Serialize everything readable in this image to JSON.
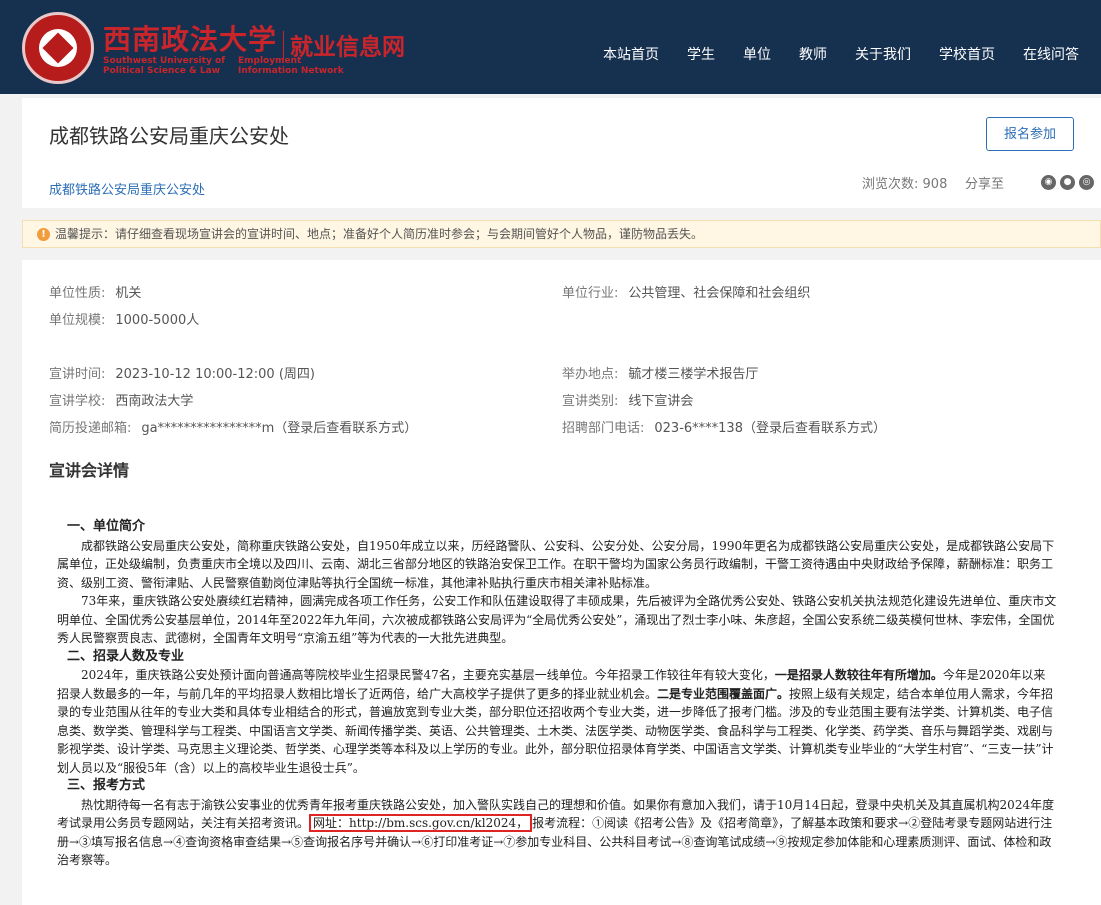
{
  "header": {
    "school_name": "西南政法大学",
    "site_name": "就业信息网",
    "school_name_en_line1": "Southwest University of",
    "school_name_en_line2": "Political Science & Law",
    "site_name_en_line1": "Employment",
    "site_name_en_line2": "Information Network",
    "nav": [
      {
        "label": "本站首页"
      },
      {
        "label": "学生"
      },
      {
        "label": "单位"
      },
      {
        "label": "教师"
      },
      {
        "label": "关于我们"
      },
      {
        "label": "学校首页"
      },
      {
        "label": "在线问答"
      }
    ]
  },
  "event": {
    "title": "成都铁路公安局重庆公安处",
    "company_link": "成都铁路公安局重庆公安处",
    "apply_button": "报名参加",
    "views_label": "浏览次数:",
    "views_count": "908",
    "share_label": "分享至"
  },
  "notice": {
    "text": "温馨提示：请仔细查看现场宣讲会的宣讲时间、地点；准备好个人简历准时参会；与会期间管好个人物品，谨防物品丢失。"
  },
  "info": {
    "nature_label": "单位性质:",
    "nature": "机关",
    "industry_label": "单位行业:",
    "industry": "公共管理、社会保障和社会组织",
    "scale_label": "单位规模:",
    "scale": "1000-5000人",
    "time_label": "宣讲时间:",
    "time": "2023-10-12 10:00-12:00 (周四)",
    "venue_label": "举办地点:",
    "venue": "毓才楼三楼学术报告厅",
    "school_label": "宣讲学校:",
    "school": "西南政法大学",
    "category_label": "宣讲类别:",
    "category": "线下宣讲会",
    "email_label": "简历投递邮箱:",
    "email": "ga****************m（登录后查看联系方式）",
    "phone_label": "招聘部门电话:",
    "phone": "023-6****138（登录后查看联系方式）"
  },
  "detail": {
    "section_title": "宣讲会详情",
    "h1": "一、单位简介",
    "p1": "成都铁路公安局重庆公安处，简称重庆铁路公安处，自1950年成立以来，历经路警队、公安科、公安分处、公安分局，1990年更名为成都铁路公安局重庆公安处，是成都铁路公安局下属单位，正处级编制，负责重庆市全境以及四川、云南、湖北三省部分地区的铁路治安保卫工作。在职干警均为国家公务员行政编制，干警工资待遇由中央财政给予保障，薪酬标准：职务工资、级别工资、警衔津贴、人民警察值勤岗位津贴等执行全国统一标准，其他津补贴执行重庆市相关津补贴标准。",
    "p2": "73年来，重庆铁路公安处赓续红岩精神，圆满完成各项工作任务，公安工作和队伍建设取得了丰硕成果，先后被评为全路优秀公安处、铁路公安机关执法规范化建设先进单位、重庆市文明单位、全国优秀公安基层单位，2014年至2022年九年间，六次被成都铁路公安局评为“全局优秀公安处”，涌现出了烈士李小味、朱彦超，全国公安系统二级英模何世林、李宏伟，全国优秀人民警察贾良志、武德树，全国青年文明号“京渝五组”等为代表的一大批先进典型。",
    "h2": "二、招录人数及专业",
    "p3_a": "2024年，重庆铁路公安处预计面向普通高等院校毕业生招录民警47名，主要充实基层一线单位。今年招录工作较往年有较大变化，",
    "p3_b1": "一是招录人数较往年有所增加。",
    "p3_c": "今年是2020年以来招录人数最多的一年，与前几年的平均招录人数相比增长了近两倍，给广大高校学子提供了更多的择业就业机会。",
    "p3_b2": "二是专业范围覆盖面广。",
    "p3_d": "按照上级有关规定，结合本单位用人需求，今年招录的专业范围从往年的专业大类和具体专业相结合的形式，普遍放宽到专业大类，部分职位还招收两个专业大类，进一步降低了报考门槛。涉及的专业范围主要有法学类、计算机类、电子信息类、数学类、管理科学与工程类、中国语言文学类、新闻传播学类、英语、公共管理类、土木类、法医学类、动物医学类、食品科学与工程类、化学类、药学类、音乐与舞蹈学类、戏剧与影视学类、设计学类、马克思主义理论类、哲学类、心理学类等本科及以上学历的专业。此外，部分职位招录体育学类、中国语言文学类、计算机类专业毕业的“大学生村官”、“三支一扶”计划人员以及“服役5年（含）以上的高校毕业生退役士兵”。",
    "h3": "三、报考方式",
    "p4_a": "热忱期待每一名有志于渝铁公安事业的优秀青年报考重庆铁路公安处，加入警队实践自己的理想和价值。如果你有意加入我们，请于10月14日起，登录中央机关及其直属机构2024年度考试录用公务员专题网站，关注有关招考资讯。",
    "p4_url": "网址：http://bm.scs.gov.cn/kl2024，",
    "p4_b": "报考流程：①阅读《招考公告》及《招考简章》，了解基本政策和要求→②登陆考录专题网站进行注册→③填写报名信息→④查询资格审查结果→⑤查询报名序号并确认→⑥打印准考证→⑦参加专业科目、公共科目考试→⑧查询笔试成绩→⑨按规定参加体能和心理素质测评、面试、体检和政治考察等。"
  },
  "colors": {
    "header_bg": "#16304f",
    "brand_red": "#c9252b",
    "link_blue": "#2d6fb6",
    "notice_bg": "#fff6e3",
    "highlight_red": "#e02424"
  }
}
